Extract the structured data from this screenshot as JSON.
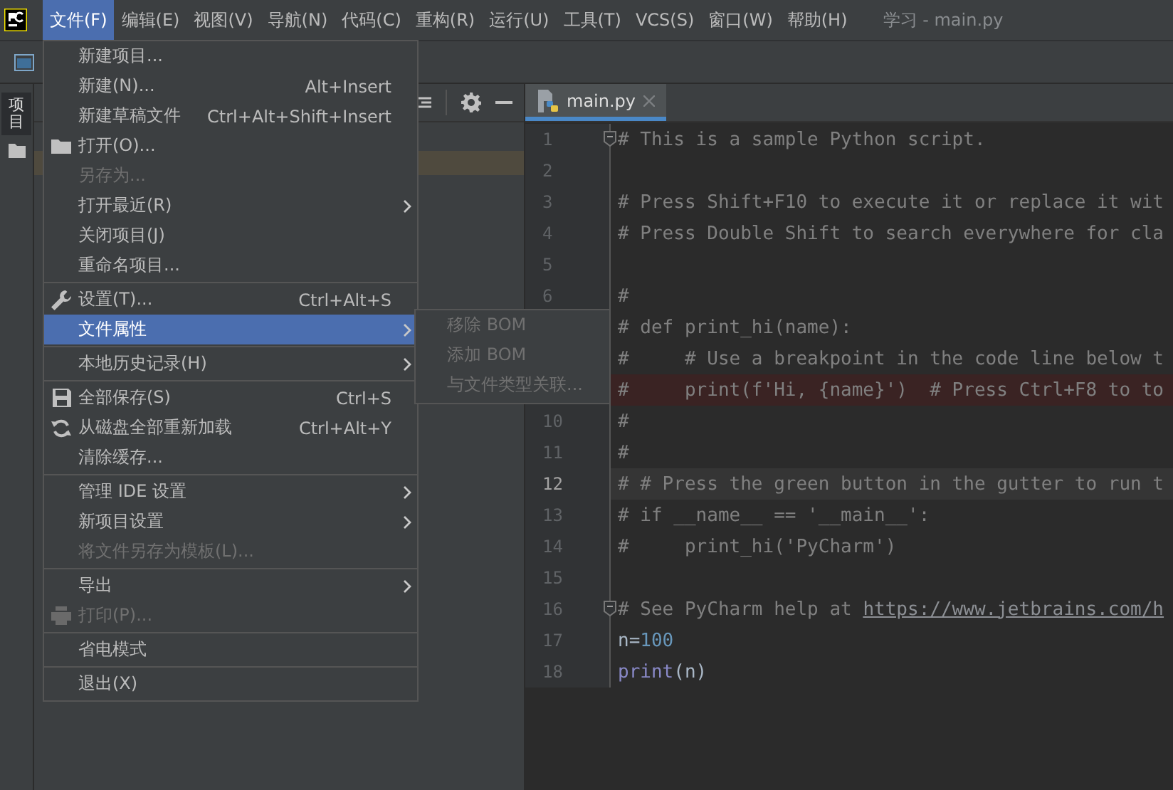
{
  "menubar": {
    "items": [
      {
        "label": "文件(F)",
        "selected": true
      },
      {
        "label": "编辑(E)",
        "selected": false
      },
      {
        "label": "视图(V)",
        "selected": false
      },
      {
        "label": "导航(N)",
        "selected": false
      },
      {
        "label": "代码(C)",
        "selected": false
      },
      {
        "label": "重构(R)",
        "selected": false
      },
      {
        "label": "运行(U)",
        "selected": false
      },
      {
        "label": "工具(T)",
        "selected": false
      },
      {
        "label": "VCS(S)",
        "selected": false
      },
      {
        "label": "窗口(W)",
        "selected": false
      },
      {
        "label": "帮助(H)",
        "selected": false
      }
    ],
    "title": "学习 - main.py"
  },
  "side_strip": {
    "tab": "项目"
  },
  "file_menu": {
    "groups": [
      [
        {
          "label": "新建项目...",
          "submenu": false,
          "disabled": false,
          "selected": false
        },
        {
          "label": "新建(N)...",
          "shortcut": "Alt+Insert",
          "submenu": false,
          "disabled": false,
          "selected": false
        },
        {
          "label": "新建草稿文件",
          "shortcut": "Ctrl+Alt+Shift+Insert",
          "submenu": false,
          "disabled": false,
          "selected": false
        },
        {
          "label": "打开(O)...",
          "submenu": false,
          "disabled": false,
          "selected": false
        },
        {
          "label": "另存为...",
          "submenu": false,
          "disabled": true,
          "selected": false
        },
        {
          "label": "打开最近(R)",
          "submenu": true,
          "disabled": false,
          "selected": false
        },
        {
          "label": "关闭项目(J)",
          "submenu": false,
          "disabled": false,
          "selected": false
        },
        {
          "label": "重命名项目...",
          "submenu": false,
          "disabled": false,
          "selected": false
        }
      ],
      [
        {
          "label": "设置(T)...",
          "shortcut": "Ctrl+Alt+S",
          "submenu": false,
          "disabled": false,
          "selected": false
        },
        {
          "label": "文件属性",
          "submenu": true,
          "disabled": false,
          "selected": true
        }
      ],
      [
        {
          "label": "本地历史记录(H)",
          "submenu": true,
          "disabled": false,
          "selected": false
        }
      ],
      [
        {
          "label": "全部保存(S)",
          "shortcut": "Ctrl+S",
          "submenu": false,
          "disabled": false,
          "selected": false
        },
        {
          "label": "从磁盘全部重新加载",
          "shortcut": "Ctrl+Alt+Y",
          "submenu": false,
          "disabled": false,
          "selected": false
        },
        {
          "label": "清除缓存...",
          "submenu": false,
          "disabled": false,
          "selected": false
        }
      ],
      [
        {
          "label": "管理 IDE 设置",
          "submenu": true,
          "disabled": false,
          "selected": false
        },
        {
          "label": "新项目设置",
          "submenu": true,
          "disabled": false,
          "selected": false
        },
        {
          "label": "将文件另存为模板(L)...",
          "submenu": false,
          "disabled": true,
          "selected": false
        }
      ],
      [
        {
          "label": "导出",
          "submenu": true,
          "disabled": false,
          "selected": false
        },
        {
          "label": "打印(P)...",
          "submenu": false,
          "disabled": true,
          "selected": false
        }
      ],
      [
        {
          "label": "省电模式",
          "submenu": false,
          "disabled": false,
          "selected": false
        }
      ],
      [
        {
          "label": "退出(X)",
          "submenu": false,
          "disabled": false,
          "selected": false
        }
      ]
    ]
  },
  "submenu": {
    "items": [
      {
        "label": "移除 BOM",
        "disabled": true
      },
      {
        "label": "添加 BOM",
        "disabled": true
      },
      {
        "label": "与文件类型关联...",
        "disabled": true
      }
    ]
  },
  "editor": {
    "tabs": [
      {
        "label": "main.py",
        "selected": true
      }
    ],
    "lines": [
      {
        "number": "1",
        "current": false,
        "breakpoint": false,
        "fold": true,
        "segments": [
          {
            "kind": "comment",
            "text": "# This is a sample Python script."
          }
        ]
      },
      {
        "number": "2",
        "current": false,
        "breakpoint": false,
        "fold": false
      },
      {
        "number": "3",
        "current": false,
        "breakpoint": false,
        "fold": false,
        "segments": [
          {
            "kind": "comment",
            "text": "# Press Shift+F10 to execute it or replace it wit"
          }
        ]
      },
      {
        "number": "4",
        "current": false,
        "breakpoint": false,
        "fold": false,
        "segments": [
          {
            "kind": "comment",
            "text": "# Press Double Shift to search everywhere for cla"
          }
        ]
      },
      {
        "number": "5",
        "current": false,
        "breakpoint": false,
        "fold": false
      },
      {
        "number": "6",
        "current": false,
        "breakpoint": false,
        "fold": false,
        "segments": [
          {
            "kind": "comment",
            "text": "#"
          }
        ]
      },
      {
        "breakpoint": false,
        "segments": [
          {
            "kind": "comment",
            "text": "# def print_hi(name):"
          }
        ]
      },
      {
        "breakpoint": false,
        "segments": [
          {
            "kind": "comment",
            "text": "#     # Use a breakpoint in the code line below t"
          }
        ]
      },
      {
        "current": false,
        "breakpoint": true,
        "segments": [
          {
            "kind": "comment",
            "text": "#     print(f'Hi, {name}')  # Press Ctrl+F8 to to"
          }
        ]
      },
      {
        "number": "10",
        "current": false,
        "breakpoint": false,
        "fold": false,
        "segments": [
          {
            "kind": "comment",
            "text": "#"
          }
        ]
      },
      {
        "number": "11",
        "current": false,
        "breakpoint": false,
        "fold": false,
        "segments": [
          {
            "kind": "comment",
            "text": "#"
          }
        ]
      },
      {
        "number": "12",
        "current": true,
        "breakpoint": false,
        "fold": false,
        "segments": [
          {
            "kind": "comment",
            "text": "# # Press the green button in the gutter to run t"
          }
        ]
      },
      {
        "number": "13",
        "current": false,
        "breakpoint": false,
        "fold": false,
        "segments": [
          {
            "kind": "comment",
            "text": "# if __name__ == '__main__':"
          }
        ]
      },
      {
        "number": "14",
        "current": false,
        "breakpoint": false,
        "fold": false,
        "segments": [
          {
            "kind": "comment",
            "text": "#     print_hi('PyCharm')"
          }
        ]
      },
      {
        "number": "15",
        "current": false,
        "breakpoint": false,
        "fold": false
      },
      {
        "number": "16",
        "current": false,
        "breakpoint": false,
        "fold": true,
        "segments": [
          {
            "kind": "comment",
            "text": "# See PyCharm help at "
          },
          {
            "kind": "link",
            "text": "https://www.jetbrains.com/h"
          }
        ]
      },
      {
        "number": "17",
        "current": false,
        "breakpoint": false,
        "fold": false,
        "segments": [
          {
            "kind": "plain",
            "text": "n="
          },
          {
            "kind": "number",
            "text": "100"
          }
        ]
      },
      {
        "number": "18",
        "current": false,
        "breakpoint": false,
        "fold": false,
        "segments": [
          {
            "kind": "builtin",
            "text": "print"
          },
          {
            "kind": "plain",
            "text": "(n)"
          }
        ]
      }
    ]
  }
}
